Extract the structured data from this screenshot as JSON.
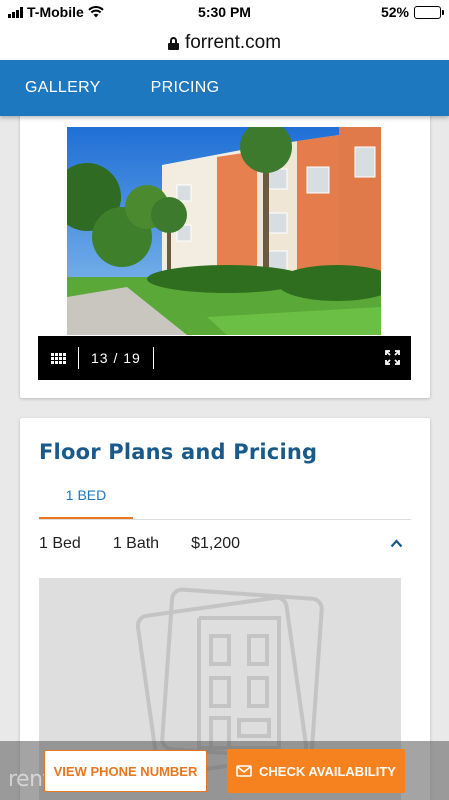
{
  "status_bar": {
    "carrier": "T-Mobile",
    "time": "5:30 PM",
    "battery": "52%",
    "battery_level": 0.52
  },
  "browser": {
    "url": "forrent.com"
  },
  "nav": {
    "tabs": [
      {
        "label": "GALLERY"
      },
      {
        "label": "PRICING"
      }
    ]
  },
  "gallery": {
    "counter": "13 / 19"
  },
  "floor_plans": {
    "title": "Floor Plans and Pricing",
    "tabs": [
      {
        "label": "1 BED",
        "active": true
      }
    ],
    "plan": {
      "beds": "1 Bed",
      "baths": "1 Bath",
      "price": "$1,200"
    }
  },
  "actions": {
    "phone_label": "VIEW PHONE NUMBER",
    "check_label": "CHECK AVAILABILITY",
    "watermark": "rentlinx"
  },
  "colors": {
    "nav_blue": "#1e78bf",
    "title_blue": "#1a5a8a",
    "accent_orange": "#e87722",
    "button_orange": "#f5821f"
  }
}
